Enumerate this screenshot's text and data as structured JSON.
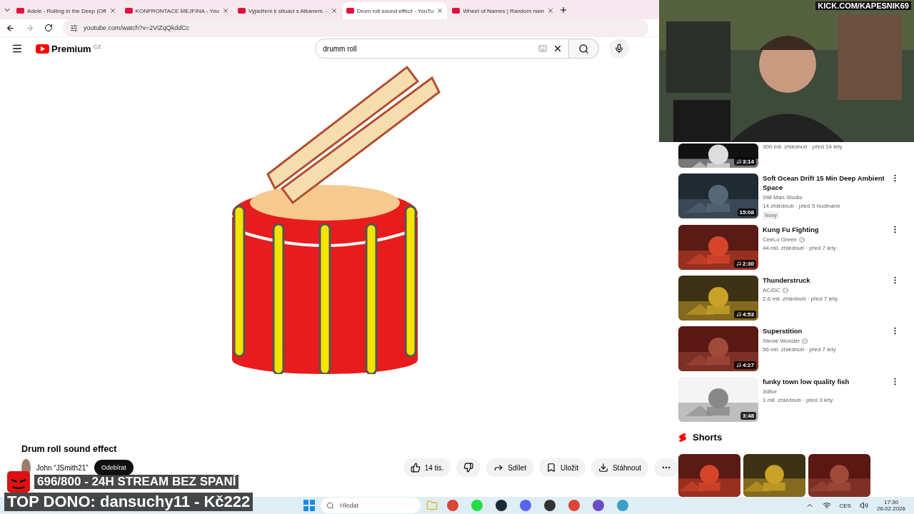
{
  "tabs": [
    {
      "title": "Adele - Rolling in the Deep (Off",
      "selected": false
    },
    {
      "title": "KONFRONTACE MEJFINA - You",
      "selected": false
    },
    {
      "title": "Vyjádření k situaci s Alkanem. -",
      "selected": false
    },
    {
      "title": "Drum roll sound effect - YouTu",
      "selected": true
    },
    {
      "title": "Wheel of Names | Random nam",
      "selected": false
    }
  ],
  "address": "youtube.com/watch?v=2ViZqQkddCc",
  "header": {
    "logo": "Premium",
    "region": "CZ",
    "search_value": "drumm roll"
  },
  "video": {
    "title": "Drum roll sound effect",
    "channel": "John “JSmith21”",
    "subscribe": "Odebírat",
    "likes": "14 tis.",
    "actions": [
      {
        "kind": "share",
        "label": "Sdílet"
      },
      {
        "kind": "save",
        "label": "Uložit"
      },
      {
        "kind": "download",
        "label": "Stáhnout"
      }
    ]
  },
  "related": [
    {
      "meta": "300 mil. zhlédnutí · před 14 lety",
      "duration": "3:14",
      "music": true
    },
    {
      "title": "Soft Ocean Drift  15 Min Deep Ambient Space",
      "channel": "Still Man Studio",
      "verified": false,
      "meta": "14 zhlédnutí · před 5 hodinami",
      "duration": "15:08",
      "music": false,
      "badge": "Nový"
    },
    {
      "title": "Kung Fu Fighting",
      "channel": "CeeLo Green",
      "verified": true,
      "meta": "44 mil. zhlédnutí · před 7 lety",
      "duration": "2:30",
      "music": true
    },
    {
      "title": "Thunderstruck",
      "channel": "AC/DC",
      "verified": true,
      "meta": "2,6 mil. zhlédnutí · před 7 lety",
      "duration": "4:53",
      "music": true
    },
    {
      "title": "Superstition",
      "channel": "Stevie Wonder",
      "verified": true,
      "meta": "56 mil. zhlédnutí · před 7 lety",
      "duration": "4:27",
      "music": true
    },
    {
      "title": "funky town low quality fish",
      "channel": "3ditor",
      "verified": false,
      "meta": "1 mil. zhlédnutí · před 3 lety",
      "duration": "3:48",
      "music": false
    }
  ],
  "shorts": {
    "title": "Shorts"
  },
  "overlay": {
    "kick": "KICK.COM/KAPESNIK69",
    "goal": "696/800 - 24H STREAM BEZ SPANÍ",
    "top_donor": "TOP DONO: dansuchy11 - Kč222"
  },
  "taskbar": {
    "search_placeholder": "Hledat",
    "language": "CES",
    "time": "17:30",
    "date": "26.02.2026"
  }
}
